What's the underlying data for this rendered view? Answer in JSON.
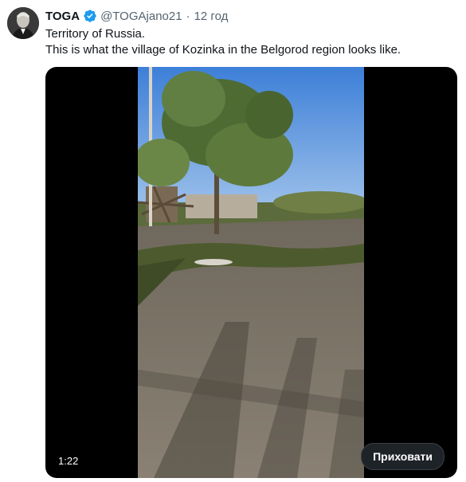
{
  "author": {
    "name": "TOGA",
    "handle": "@TOGAjano21",
    "separator": "·",
    "time": "12 год",
    "verified": true,
    "verified_color": "#1d9bf0"
  },
  "tweet": {
    "lines": [
      "Territory of Russia.",
      "This is what the village of Kozinka in the Belgorod region looks like."
    ]
  },
  "video": {
    "duration": "1:22",
    "hide_label": "Приховати"
  },
  "icons": {
    "avatar": "avatar-image",
    "verified": "verified-badge-icon"
  }
}
